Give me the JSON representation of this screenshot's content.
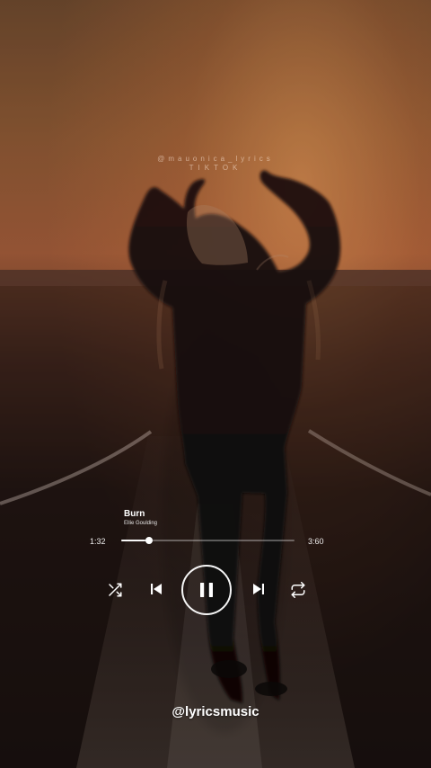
{
  "overlay": {
    "watermark_line_1": "@mauonica_lyrics",
    "watermark_line_2": "TIKTOK"
  },
  "player": {
    "title": "Burn",
    "artist": "Ellie Goulding",
    "current_time": "1:32",
    "total_time": "3:60",
    "progress": 0.16
  },
  "controls": {
    "shuffle_icon": "shuffle-icon",
    "previous_icon": "skip-previous-icon",
    "play_pause_icon": "pause-icon",
    "next_icon": "skip-next-icon",
    "repeat_icon": "repeat-icon"
  },
  "footer": {
    "handle": "@lyricsmusic"
  },
  "colors": {
    "sky_orange": "#a45d3a",
    "dark_ground": "#130d0b",
    "text": "#ffffff"
  }
}
